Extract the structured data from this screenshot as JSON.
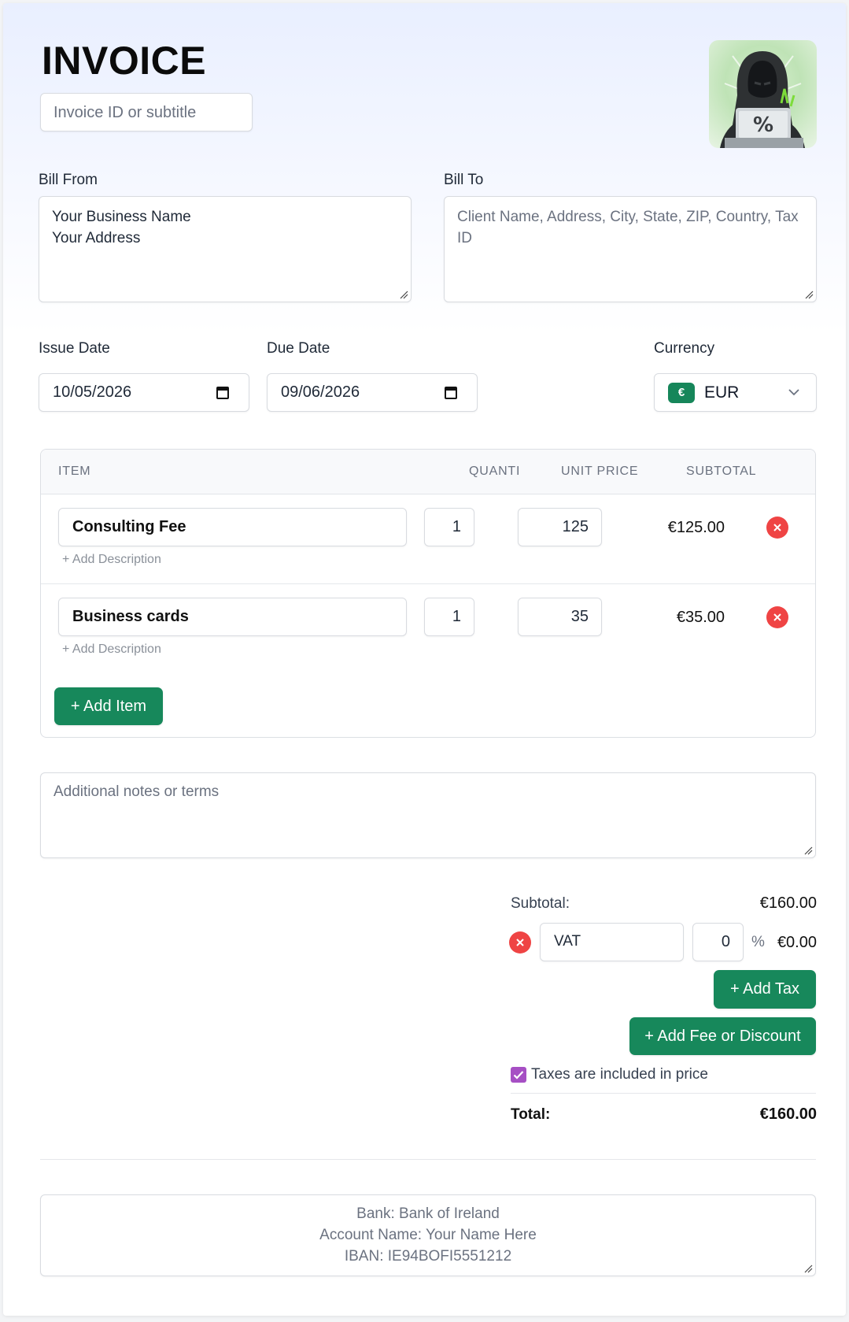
{
  "header": {
    "title": "INVOICE",
    "subtitle_placeholder": "Invoice ID or subtitle",
    "logo_text": "%"
  },
  "bill_from": {
    "label": "Bill From",
    "lines": [
      "Your Business Name",
      "Your Address"
    ]
  },
  "bill_to": {
    "label": "Bill To",
    "placeholder_line1": "Client Name, Address, City, State, ZIP, Country, Tax",
    "placeholder_line2": "ID"
  },
  "dates": {
    "issue_label": "Issue Date",
    "issue_value": "10/05/2026",
    "due_label": "Due Date",
    "due_value": "09/06/2026"
  },
  "currency": {
    "label": "Currency",
    "symbol": "€",
    "code": "EUR"
  },
  "items_table": {
    "headers": [
      "ITEM",
      "QUANTI",
      "UNIT PRICE",
      "SUBTOTAL"
    ],
    "add_description": "+ Add Description",
    "rows": [
      {
        "name": "Consulting Fee",
        "quantity": "1",
        "unit_price": "125",
        "subtotal": "€125.00"
      },
      {
        "name": "Business cards",
        "quantity": "1",
        "unit_price": "35",
        "subtotal": "€35.00"
      }
    ],
    "add_item_label": "+ Add Item"
  },
  "notes": {
    "placeholder": "Additional notes or terms"
  },
  "totals": {
    "subtotal_label": "Subtotal:",
    "subtotal_value": "€160.00",
    "tax_name": "VAT",
    "tax_rate": "0",
    "tax_percent_sign": "%",
    "tax_amount": "€0.00",
    "add_tax_label": "+ Add Tax",
    "add_fee_label": "+ Add Fee or Discount",
    "taxes_included_label": "Taxes are included in price",
    "taxes_included_checked": true,
    "total_label": "Total:",
    "total_value": "€160.00"
  },
  "bank": {
    "lines": [
      "Bank: Bank of Ireland",
      "Account Name: Your Name Here",
      "IBAN: IE94BOFI5551212"
    ]
  },
  "colors": {
    "accent_green": "#17885b",
    "delete_red": "#ef4444",
    "checkbox_purple": "#a64fc4"
  }
}
